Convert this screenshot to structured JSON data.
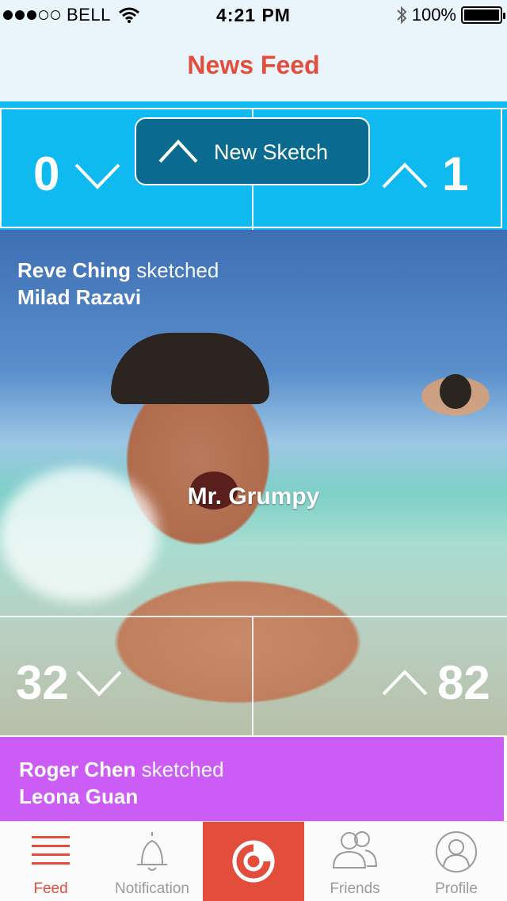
{
  "status_bar": {
    "carrier": "BELL",
    "time": "4:21 PM",
    "battery": "100%"
  },
  "nav": {
    "title": "News Feed"
  },
  "cards": [
    {
      "color": "#0fbaf1",
      "down_votes": "0",
      "up_votes": "1"
    },
    {
      "author": "Reve Ching",
      "verb": "sketched",
      "subject": "Milad Razavi",
      "caption": "Mr. Grumpy",
      "down_votes": "32",
      "up_votes": "82"
    },
    {
      "color": "#cb5cf6",
      "author": "Roger Chen",
      "verb": "sketched",
      "subject": "Leona Guan"
    }
  ],
  "new_sketch": {
    "label": "New Sketch"
  },
  "tabs": [
    {
      "label": "Feed",
      "icon": "menu-lines-icon",
      "active": true
    },
    {
      "label": "Notification",
      "icon": "bell-icon"
    },
    {
      "label": "",
      "icon": "camera-logo-icon"
    },
    {
      "label": "Friends",
      "icon": "friends-icon"
    },
    {
      "label": "Profile",
      "icon": "profile-icon"
    }
  ],
  "colors": {
    "accent": "#e34d3c",
    "blue": "#0fbaf1",
    "purple": "#cb5cf6"
  }
}
